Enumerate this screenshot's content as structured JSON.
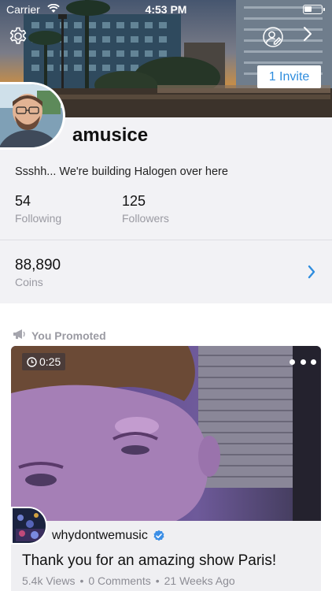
{
  "status_bar": {
    "carrier": "Carrier",
    "time": "4:53 PM"
  },
  "header": {
    "invite_label": "1 Invite",
    "icons": [
      "gear-icon",
      "edit-profile-icon",
      "chevron-right-icon"
    ]
  },
  "profile": {
    "username": "amusice",
    "bio": "Ssshh... We're building Halogen over here",
    "following_count": "54",
    "following_label": "Following",
    "followers_count": "125",
    "followers_label": "Followers",
    "coins_count": "88,890",
    "coins_label": "Coins"
  },
  "feed": {
    "section_label": "You Promoted",
    "section_icon": "megaphone-icon",
    "video": {
      "duration": "0:25",
      "channel": "whydontwemusic",
      "verified": true,
      "title": "Thank you for an amazing show Paris!",
      "views": "5.4k Views",
      "comments": "0 Comments",
      "age": "21 Weeks Ago"
    }
  },
  "colors": {
    "accent": "#2f8dde",
    "page_background": "#f2f2f5",
    "secondary_text": "#9a9aa2",
    "verified_badge": "#3b8ee6"
  }
}
